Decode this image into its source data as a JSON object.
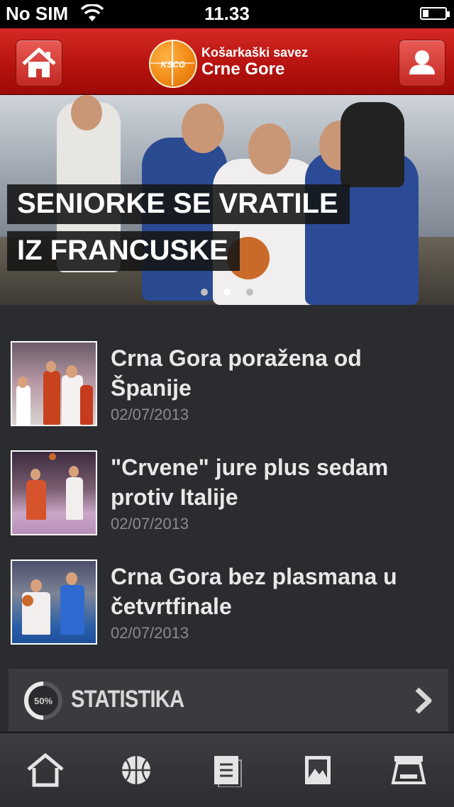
{
  "status_bar": {
    "carrier": "No SIM",
    "time": "11.33",
    "battery_level": 0.25
  },
  "header": {
    "logo_text": "KSCG",
    "brand_line1": "Košarkaški savez",
    "brand_line2": "Crne Gore",
    "home_icon": "home-icon",
    "user_icon": "user-icon",
    "accent_color": "#c01a15"
  },
  "hero": {
    "headline_line1": "SENIORKE SE VRATILE",
    "headline_line2": "IZ FRANCUSKE",
    "page_count": 3,
    "active_page": 2
  },
  "news": [
    {
      "title": "Crna Gora poražena od Španije",
      "date": "02/07/2013"
    },
    {
      "title": "\"Crvene\" jure plus sedam protiv Italije",
      "date": "02/07/2013"
    },
    {
      "title": "Crna Gora bez plasmana u četvrtfinale",
      "date": "02/07/2013"
    }
  ],
  "stats": {
    "label": "STATISTIKA",
    "gauge_text": "50%",
    "gauge_value": 0.5
  },
  "tabbar": {
    "tabs": [
      "home-icon",
      "basketball-icon",
      "document-icon",
      "image-icon",
      "printer-icon"
    ]
  }
}
